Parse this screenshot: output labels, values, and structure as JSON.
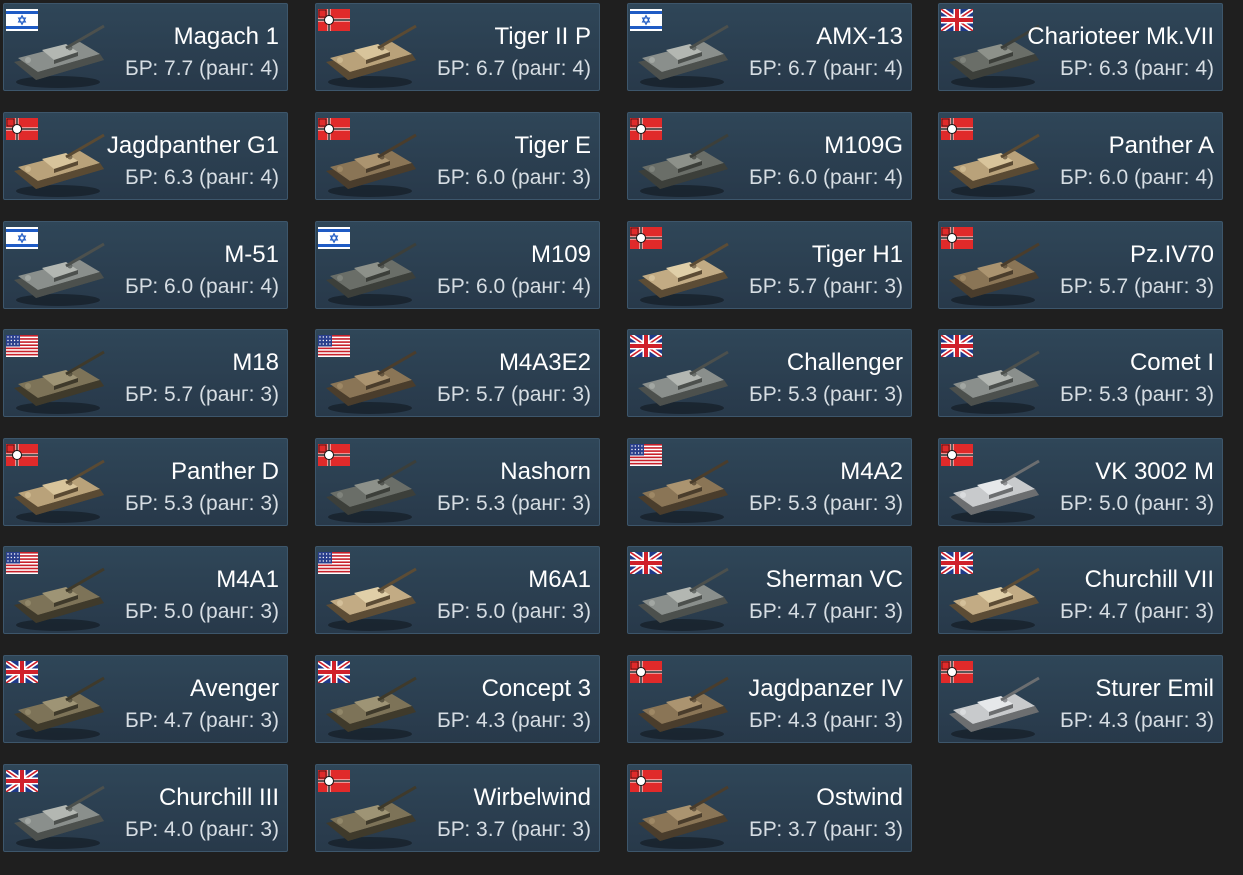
{
  "colors": {
    "background": "#1f1f1f",
    "card_background": "#2b4052",
    "card_border": "#3d566b",
    "name_text": "#ffffff",
    "br_text": "#d6dde3"
  },
  "vehicles": [
    {
      "name": "Magach 1",
      "br": "БР: 7.7 (ранг: 4)",
      "nation": "israel",
      "flag_icon": "israel-flag-icon",
      "camo": "grey"
    },
    {
      "name": "Tiger II P",
      "br": "БР: 6.7 (ранг: 4)",
      "nation": "germany",
      "flag_icon": "germany-flag-icon",
      "camo": "sand"
    },
    {
      "name": "AMX-13",
      "br": "БР: 6.7 (ранг: 4)",
      "nation": "israel",
      "flag_icon": "israel-flag-icon",
      "camo": "grey"
    },
    {
      "name": "Charioteer Mk.VII",
      "br": "БР: 6.3 (ранг: 4)",
      "nation": "uk",
      "flag_icon": "uk-flag-icon",
      "camo": "darkgrey"
    },
    {
      "name": "Jagdpanther G1",
      "br": "БР: 6.3 (ранг: 4)",
      "nation": "germany",
      "flag_icon": "germany-flag-icon",
      "camo": "sand"
    },
    {
      "name": "Tiger E",
      "br": "БР: 6.0 (ранг: 3)",
      "nation": "germany",
      "flag_icon": "germany-flag-icon",
      "camo": "brown"
    },
    {
      "name": "M109G",
      "br": "БР: 6.0 (ранг: 4)",
      "nation": "germany",
      "flag_icon": "germany-flag-icon",
      "camo": "darkgrey"
    },
    {
      "name": "Panther A",
      "br": "БР: 6.0 (ранг: 4)",
      "nation": "germany",
      "flag_icon": "germany-flag-icon",
      "camo": "sand"
    },
    {
      "name": "M-51",
      "br": "БР: 6.0 (ранг: 4)",
      "nation": "israel",
      "flag_icon": "israel-flag-icon",
      "camo": "grey"
    },
    {
      "name": "M109",
      "br": "БР: 6.0 (ранг: 4)",
      "nation": "israel",
      "flag_icon": "israel-flag-icon",
      "camo": "darkgrey"
    },
    {
      "name": "Tiger H1",
      "br": "БР: 5.7 (ранг: 3)",
      "nation": "germany",
      "flag_icon": "germany-flag-icon",
      "camo": "tan"
    },
    {
      "name": "Pz.IV70",
      "br": "БР: 5.7 (ранг: 3)",
      "nation": "germany",
      "flag_icon": "germany-flag-icon",
      "camo": "brown"
    },
    {
      "name": "M18",
      "br": "БР: 5.7 (ранг: 3)",
      "nation": "usa",
      "flag_icon": "usa-flag-icon",
      "camo": "olive"
    },
    {
      "name": "M4A3E2",
      "br": "БР: 5.7 (ранг: 3)",
      "nation": "usa",
      "flag_icon": "usa-flag-icon",
      "camo": "brown"
    },
    {
      "name": "Challenger",
      "br": "БР: 5.3 (ранг: 3)",
      "nation": "uk",
      "flag_icon": "uk-flag-icon",
      "camo": "grey"
    },
    {
      "name": "Comet I",
      "br": "БР: 5.3 (ранг: 3)",
      "nation": "uk",
      "flag_icon": "uk-flag-icon",
      "camo": "grey"
    },
    {
      "name": "Panther D",
      "br": "БР: 5.3 (ранг: 3)",
      "nation": "germany",
      "flag_icon": "germany-flag-icon",
      "camo": "sand"
    },
    {
      "name": "Nashorn",
      "br": "БР: 5.3 (ранг: 3)",
      "nation": "germany",
      "flag_icon": "germany-flag-icon",
      "camo": "darkgrey"
    },
    {
      "name": "M4A2",
      "br": "БР: 5.3 (ранг: 3)",
      "nation": "usa",
      "flag_icon": "usa-flag-icon",
      "camo": "brown"
    },
    {
      "name": "VK 3002 M",
      "br": "БР: 5.0 (ранг: 3)",
      "nation": "germany",
      "flag_icon": "germany-flag-icon",
      "camo": "light"
    },
    {
      "name": "M4A1",
      "br": "БР: 5.0 (ранг: 3)",
      "nation": "usa",
      "flag_icon": "usa-flag-icon",
      "camo": "olive"
    },
    {
      "name": "M6A1",
      "br": "БР: 5.0 (ранг: 3)",
      "nation": "usa",
      "flag_icon": "usa-flag-icon",
      "camo": "tan"
    },
    {
      "name": "Sherman VC",
      "br": "БР: 4.7 (ранг: 3)",
      "nation": "uk",
      "flag_icon": "uk-flag-icon",
      "camo": "grey"
    },
    {
      "name": "Churchill VII",
      "br": "БР: 4.7 (ранг: 3)",
      "nation": "uk",
      "flag_icon": "uk-flag-icon",
      "camo": "tan"
    },
    {
      "name": "Avenger",
      "br": "БР: 4.7 (ранг: 3)",
      "nation": "uk",
      "flag_icon": "uk-flag-icon",
      "camo": "olive"
    },
    {
      "name": "Concept 3",
      "br": "БР: 4.3 (ранг: 3)",
      "nation": "uk",
      "flag_icon": "uk-flag-icon",
      "camo": "olive"
    },
    {
      "name": "Jagdpanzer IV",
      "br": "БР: 4.3 (ранг: 3)",
      "nation": "germany",
      "flag_icon": "germany-flag-icon",
      "camo": "brown"
    },
    {
      "name": "Sturer Emil",
      "br": "БР: 4.3 (ранг: 3)",
      "nation": "germany",
      "flag_icon": "germany-flag-icon",
      "camo": "light"
    },
    {
      "name": "Churchill III",
      "br": "БР: 4.0 (ранг: 3)",
      "nation": "uk",
      "flag_icon": "uk-flag-icon",
      "camo": "grey"
    },
    {
      "name": "Wirbelwind",
      "br": "БР: 3.7 (ранг: 3)",
      "nation": "germany",
      "flag_icon": "germany-flag-icon",
      "camo": "olive"
    },
    {
      "name": "Ostwind",
      "br": "БР: 3.7 (ранг: 3)",
      "nation": "germany",
      "flag_icon": "germany-flag-icon",
      "camo": "brown"
    }
  ]
}
